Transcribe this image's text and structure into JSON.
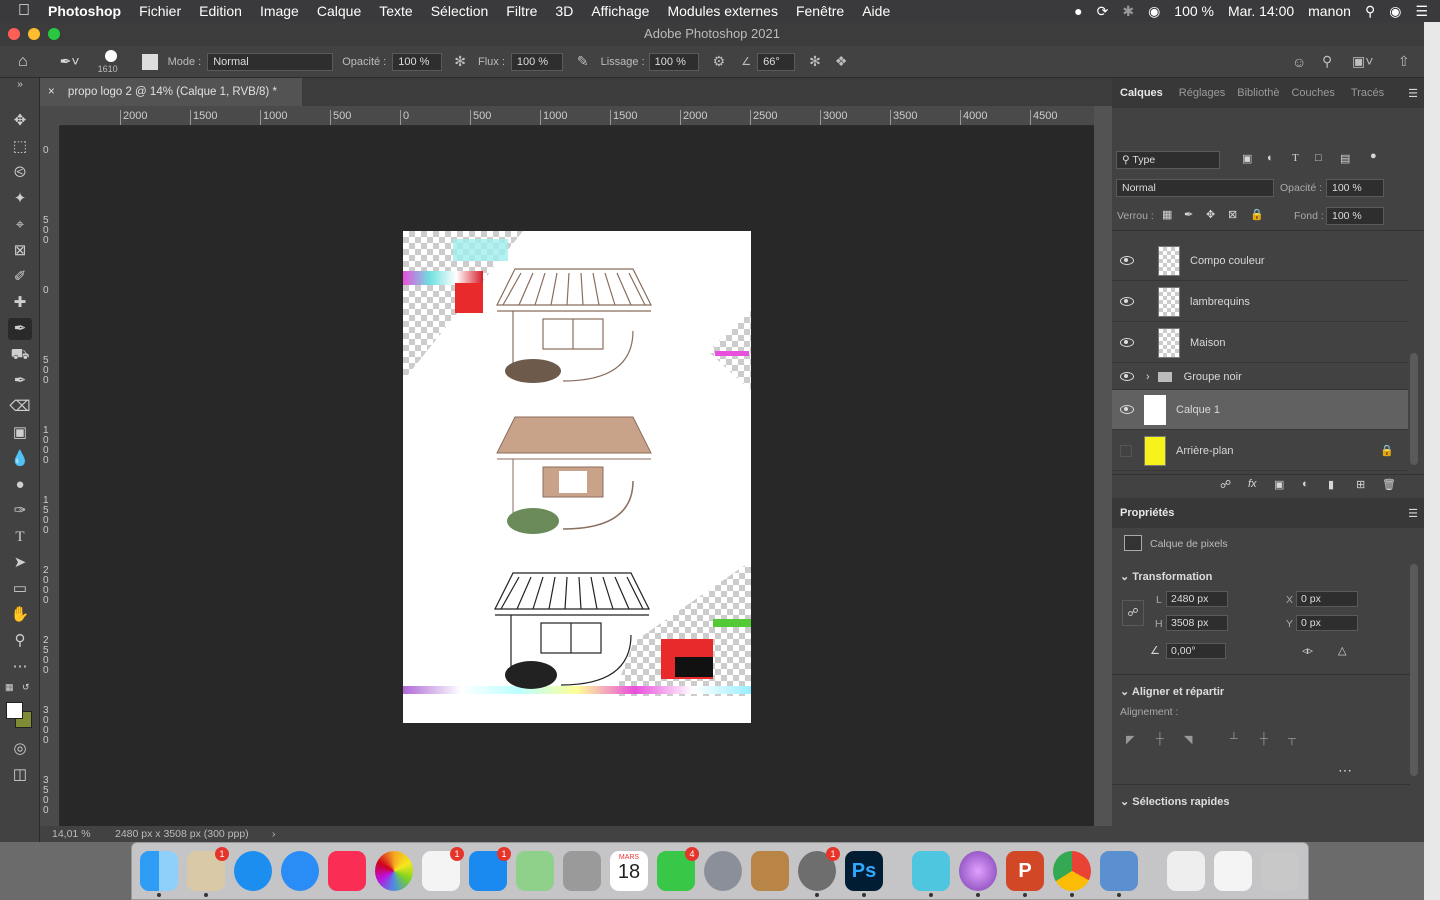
{
  "menubar": {
    "apple": "",
    "app_name": "Photoshop",
    "items": [
      "Fichier",
      "Edition",
      "Image",
      "Calque",
      "Texte",
      "Sélection",
      "Filtre",
      "3D",
      "Affichage",
      "Modules externes",
      "Fenêtre",
      "Aide"
    ],
    "battery": "100 %",
    "clock": "Mar. 14:00",
    "user": "manon"
  },
  "window": {
    "title": "Adobe Photoshop 2021"
  },
  "options": {
    "brush_size": "1610",
    "mode_label": "Mode :",
    "mode_value": "Normal",
    "opacity_label": "Opacité :",
    "opacity_value": "100 %",
    "flux_label": "Flux :",
    "flux_value": "100 %",
    "smoothing_label": "Lissage :",
    "smoothing_value": "100 %",
    "angle_value": "66°"
  },
  "document": {
    "tab_title": "propo logo 2 @ 14% (Calque 1, RVB/8) *",
    "zoom": "14,01 %",
    "info": "2480 px x 3508 px (300 ppp)"
  },
  "ruler_h_labels": [
    "2000",
    "1500",
    "1000",
    "500",
    "0",
    "500",
    "1000",
    "1500",
    "2000",
    "2500",
    "3000",
    "3500",
    "4000",
    "4500"
  ],
  "ruler_v_labels": [
    "0",
    "5\n0\n0",
    "0",
    "5\n0\n0",
    "1\n0\n0\n0",
    "1\n5\n0\n0",
    "2\n0\n0\n0",
    "2\n5\n0\n0",
    "3\n0\n0\n0",
    "3\n5\n0\n0",
    "4\n0\n0"
  ],
  "layers_panel": {
    "tabs": [
      "Calques",
      "Réglages",
      "Bibliothè",
      "Couches",
      "Tracés"
    ],
    "filter": "Type",
    "blend_mode": "Normal",
    "opacity_label": "Opacité :",
    "opacity_value": "100 %",
    "lock_label": "Verrou :",
    "fill_label": "Fond :",
    "fill_value": "100 %",
    "layers": [
      {
        "name": "Compo couleur",
        "visible": true
      },
      {
        "name": "lambrequins",
        "visible": true
      },
      {
        "name": "Maison",
        "visible": true
      },
      {
        "name": "Groupe noir",
        "visible": true
      },
      {
        "name": "Calque 1",
        "visible": true
      },
      {
        "name": "Arrière-plan",
        "visible": false
      }
    ]
  },
  "properties_panel": {
    "tab": "Propriétés",
    "kind": "Calque de pixels",
    "transform_title": "Transformation",
    "w_label": "L",
    "w_value": "2480 px",
    "h_label": "H",
    "h_value": "3508 px",
    "x_label": "X",
    "x_value": "0 px",
    "y_label": "Y",
    "y_value": "0 px",
    "angle_value": "0,00°",
    "align_title": "Aligner et répartir",
    "align_label": "Alignement :",
    "quick_title": "Sélections rapides"
  },
  "dock": {
    "calendar_month": "MARS",
    "calendar_day": "18",
    "photoshop_label": "Ps",
    "powerpoint_label": "P",
    "badges": {
      "mail": "1",
      "notes": "1",
      "appstore": "1",
      "facetime": "4",
      "prefs": "1"
    }
  },
  "colors": {
    "accent": "#0a84ff",
    "canvas_bg": "#282828",
    "panel_bg": "#424242"
  }
}
